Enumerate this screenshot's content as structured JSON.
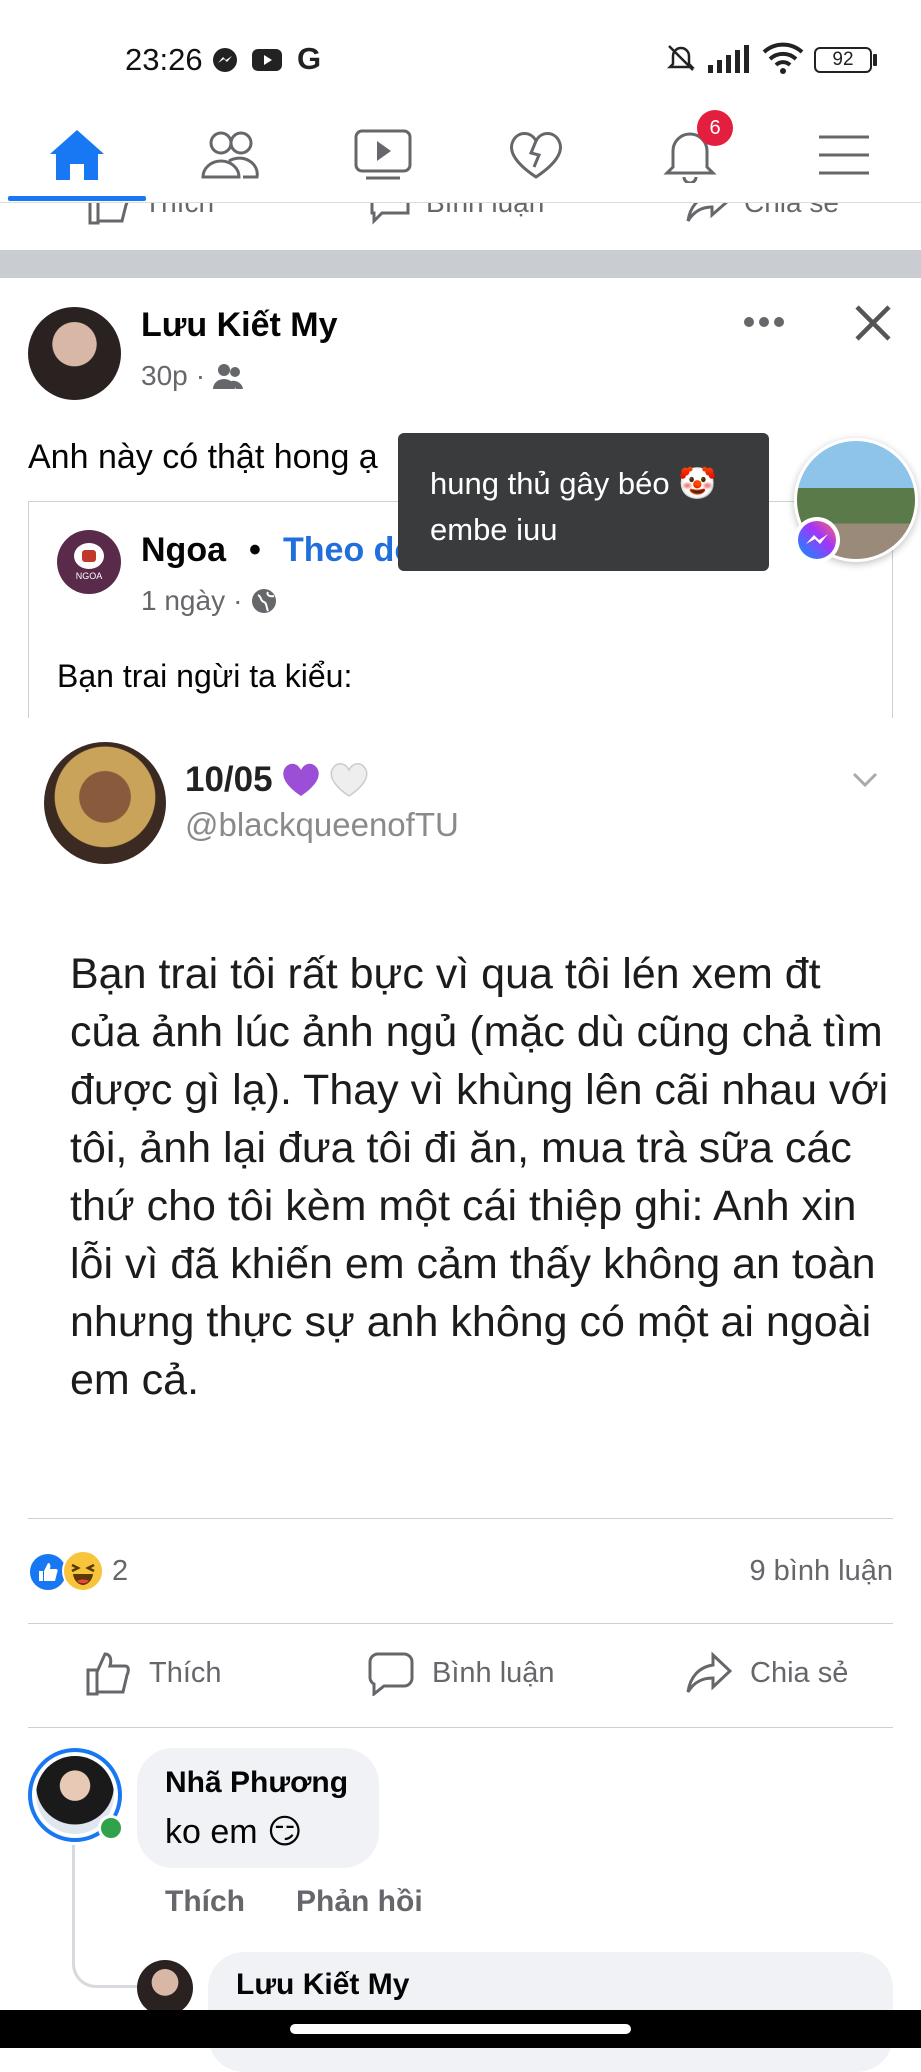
{
  "status_bar": {
    "time": "23:26",
    "notification_icons": [
      "messenger-icon",
      "youtube-icon",
      "google-icon"
    ],
    "battery": "92"
  },
  "nav": {
    "tabs": [
      "home-icon",
      "friends-icon",
      "watch-icon",
      "dating-icon",
      "notifications-icon",
      "menu-icon"
    ],
    "notification_badge": "6",
    "active_tab": "home"
  },
  "previous_post_actions": {
    "like": "Thích",
    "comment": "Bình luận",
    "share": "Chia sẻ"
  },
  "post": {
    "author": "Lưu Kiết My",
    "time": "30p",
    "time_separator": "·",
    "text": "Anh này có thật hong ạ",
    "shared": {
      "page_name": "Ngoa",
      "separator": "•",
      "follow_label": "Theo dõi",
      "time": "1 ngày",
      "time_separator": "·",
      "text": "Bạn trai ngừi ta kiểu:",
      "avatar_logo_text": "NGOA",
      "tweet": {
        "date": "10/05",
        "handle": "@blackqueenofTU",
        "body": "Bạn trai tôi rất bực vì qua tôi lén xem đt của ảnh lúc ảnh ngủ (mặc dù cũng chả tìm được gì lạ). Thay vì khùng lên cãi nhau với tôi, ảnh lại đưa tôi đi ăn, mua trà sữa các thứ cho tôi kèm một cái thiệp ghi: Anh xin lỗi vì đã khiến em cảm thấy không an toàn nhưng thực sự anh không có một ai ngoài em cả."
      }
    },
    "reaction_count": "2",
    "comment_count": "9 bình luận",
    "actions": {
      "like": "Thích",
      "comment": "Bình luận",
      "share": "Chia sẻ"
    }
  },
  "chat_head": {
    "tooltip_line1": "hung thủ gây béo 🤡",
    "tooltip_line2": "embe iuu"
  },
  "comments": [
    {
      "name": "Nhã Phương",
      "text": "ko em 😏",
      "like": "Thích",
      "reply": "Phản hồi"
    },
    {
      "name": "Lưu Kiết My"
    }
  ],
  "colors": {
    "brand_blue": "#1877f2",
    "follow_blue": "#216fdb",
    "secondary_text": "#65676b",
    "online_green": "#31a24c",
    "badge_red": "#e41e3f"
  }
}
